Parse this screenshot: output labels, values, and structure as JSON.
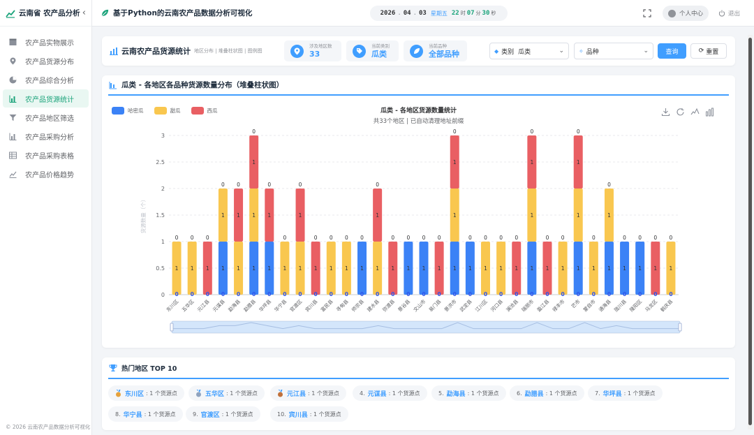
{
  "sidebar": {
    "title": "云南省 农产品分析",
    "items": [
      {
        "label": "农产品实物展示",
        "icon": "table-icon"
      },
      {
        "label": "农产品货源分布",
        "icon": "location-pin-icon"
      },
      {
        "label": "农产品综合分析",
        "icon": "pie-chart-icon"
      },
      {
        "label": "农产品货源统计",
        "icon": "bar-chart-icon",
        "active": true
      },
      {
        "label": "农产品地区筛选",
        "icon": "filter-icon"
      },
      {
        "label": "农产品采购分析",
        "icon": "bar-chart-icon"
      },
      {
        "label": "农产品采购表格",
        "icon": "table-grid-icon"
      },
      {
        "label": "农产品价格趋势",
        "icon": "line-chart-icon"
      }
    ],
    "footer": "© 2026 云南农产品数据分析可视化"
  },
  "header": {
    "title": "基于Python的云南农产品数据分析可视化",
    "clock": {
      "year": "2026",
      "month": "04",
      "day": "03",
      "weekday": "星期五",
      "hour": "22",
      "minute": "07",
      "second": "30",
      "u_hour": "时",
      "u_min": "分",
      "u_sec": "秒"
    },
    "profile_label": "个人中心",
    "logout_label": "退出"
  },
  "filterbar": {
    "title": "云南农产品货源统计",
    "subtitle": "地区分布 | 堆叠柱状图 | 图例图",
    "stats": [
      {
        "label": "涉及地区数",
        "value": "33",
        "icon": "location-pin-icon"
      },
      {
        "label": "当前类别",
        "value": "瓜类",
        "icon": "tag-icon"
      },
      {
        "label": "当前品种",
        "value": "全部品种",
        "icon": "leaf-icon"
      }
    ],
    "category_prefix": "类别",
    "category_value": "瓜类",
    "variety_placeholder": "品种",
    "query_label": "查询",
    "reset_label": "重置"
  },
  "chart_card": {
    "header": "瓜类 - 各地区各品种货源数量分布（堆叠柱状图）"
  },
  "chart_data": {
    "type": "bar",
    "stacked": true,
    "title": "瓜类 - 各地区货源数量统计",
    "subtitle": "共33个地区 | 已自动清理地址前缀",
    "ylabel": "货源数量（个）",
    "xlabel": "",
    "ylim": [
      0,
      3
    ],
    "yticks": [
      0,
      0.5,
      1,
      1.5,
      2,
      2.5,
      3
    ],
    "grid": true,
    "legend_position": "top-left",
    "categories": [
      "东川区",
      "五华区",
      "元江县",
      "元谋县",
      "勐海县",
      "勐腊县",
      "华坪县",
      "华宁县",
      "官渡区",
      "宾川县",
      "富民县",
      "寻甸县",
      "师宗县",
      "建水县",
      "弥渡县",
      "景谷县",
      "文山市",
      "易门县",
      "景洪市",
      "武定县",
      "江川区",
      "河口县",
      "澜沧县",
      "瑞丽市",
      "盈江县",
      "禄丰市",
      "芒市",
      "蒙自市",
      "通海县",
      "陇川县",
      "隆阳区",
      "马龙区",
      "鹤庆县"
    ],
    "series": [
      {
        "name": "哈密瓜",
        "color": "#3b82f6",
        "values": [
          0,
          0,
          0,
          1,
          0,
          1,
          1,
          0,
          0,
          0,
          0,
          0,
          1,
          0,
          0,
          1,
          1,
          0,
          1,
          1,
          0,
          0,
          0,
          1,
          0,
          0,
          1,
          0,
          1,
          1,
          1,
          0,
          0
        ]
      },
      {
        "name": "甜瓜",
        "color": "#f9c74f",
        "values": [
          1,
          1,
          0,
          1,
          1,
          1,
          0,
          1,
          1,
          0,
          1,
          1,
          0,
          1,
          0,
          0,
          0,
          0,
          1,
          0,
          1,
          1,
          0,
          1,
          0,
          1,
          1,
          1,
          1,
          0,
          0,
          0,
          1
        ]
      },
      {
        "name": "西瓜",
        "color": "#e95f63",
        "values": [
          0,
          0,
          1,
          0,
          1,
          1,
          1,
          0,
          1,
          1,
          0,
          0,
          0,
          1,
          1,
          0,
          0,
          1,
          1,
          0,
          0,
          0,
          1,
          1,
          1,
          0,
          1,
          0,
          0,
          0,
          0,
          1,
          0
        ]
      }
    ]
  },
  "hot": {
    "title": "热门地区 TOP 10",
    "suffix": "1 个货源点",
    "items": [
      {
        "rank": "",
        "name": "东川区",
        "medal": "gold",
        "text": ": 1 个货源点"
      },
      {
        "rank": "",
        "name": "五华区",
        "medal": "silver",
        "text": ": 1 个货源点"
      },
      {
        "rank": "",
        "name": "元江县",
        "medal": "bronze",
        "text": ": 1 个货源点"
      },
      {
        "rank": "4.",
        "name": "元谋县",
        "text": ": 1 个货源点"
      },
      {
        "rank": "5.",
        "name": "勐海县",
        "text": ": 1 个货源点"
      },
      {
        "rank": "6.",
        "name": "勐腊县",
        "text": ": 1 个货源点"
      },
      {
        "rank": "7.",
        "name": "华坪县",
        "text": ": 1 个货源点"
      },
      {
        "rank": "8.",
        "name": "华宁县",
        "text": ": 1 个货源点"
      },
      {
        "rank": "9.",
        "name": "官渡区",
        "text": ": 1 个货源点"
      },
      {
        "rank": "10.",
        "name": "宾川县",
        "text": ": 1 个货源点"
      }
    ]
  },
  "colors": {
    "accent": "#409eff",
    "brand": "#1aa37a",
    "melon": "#3b82f6",
    "sweet": "#f9c74f",
    "water": "#e95f63"
  }
}
